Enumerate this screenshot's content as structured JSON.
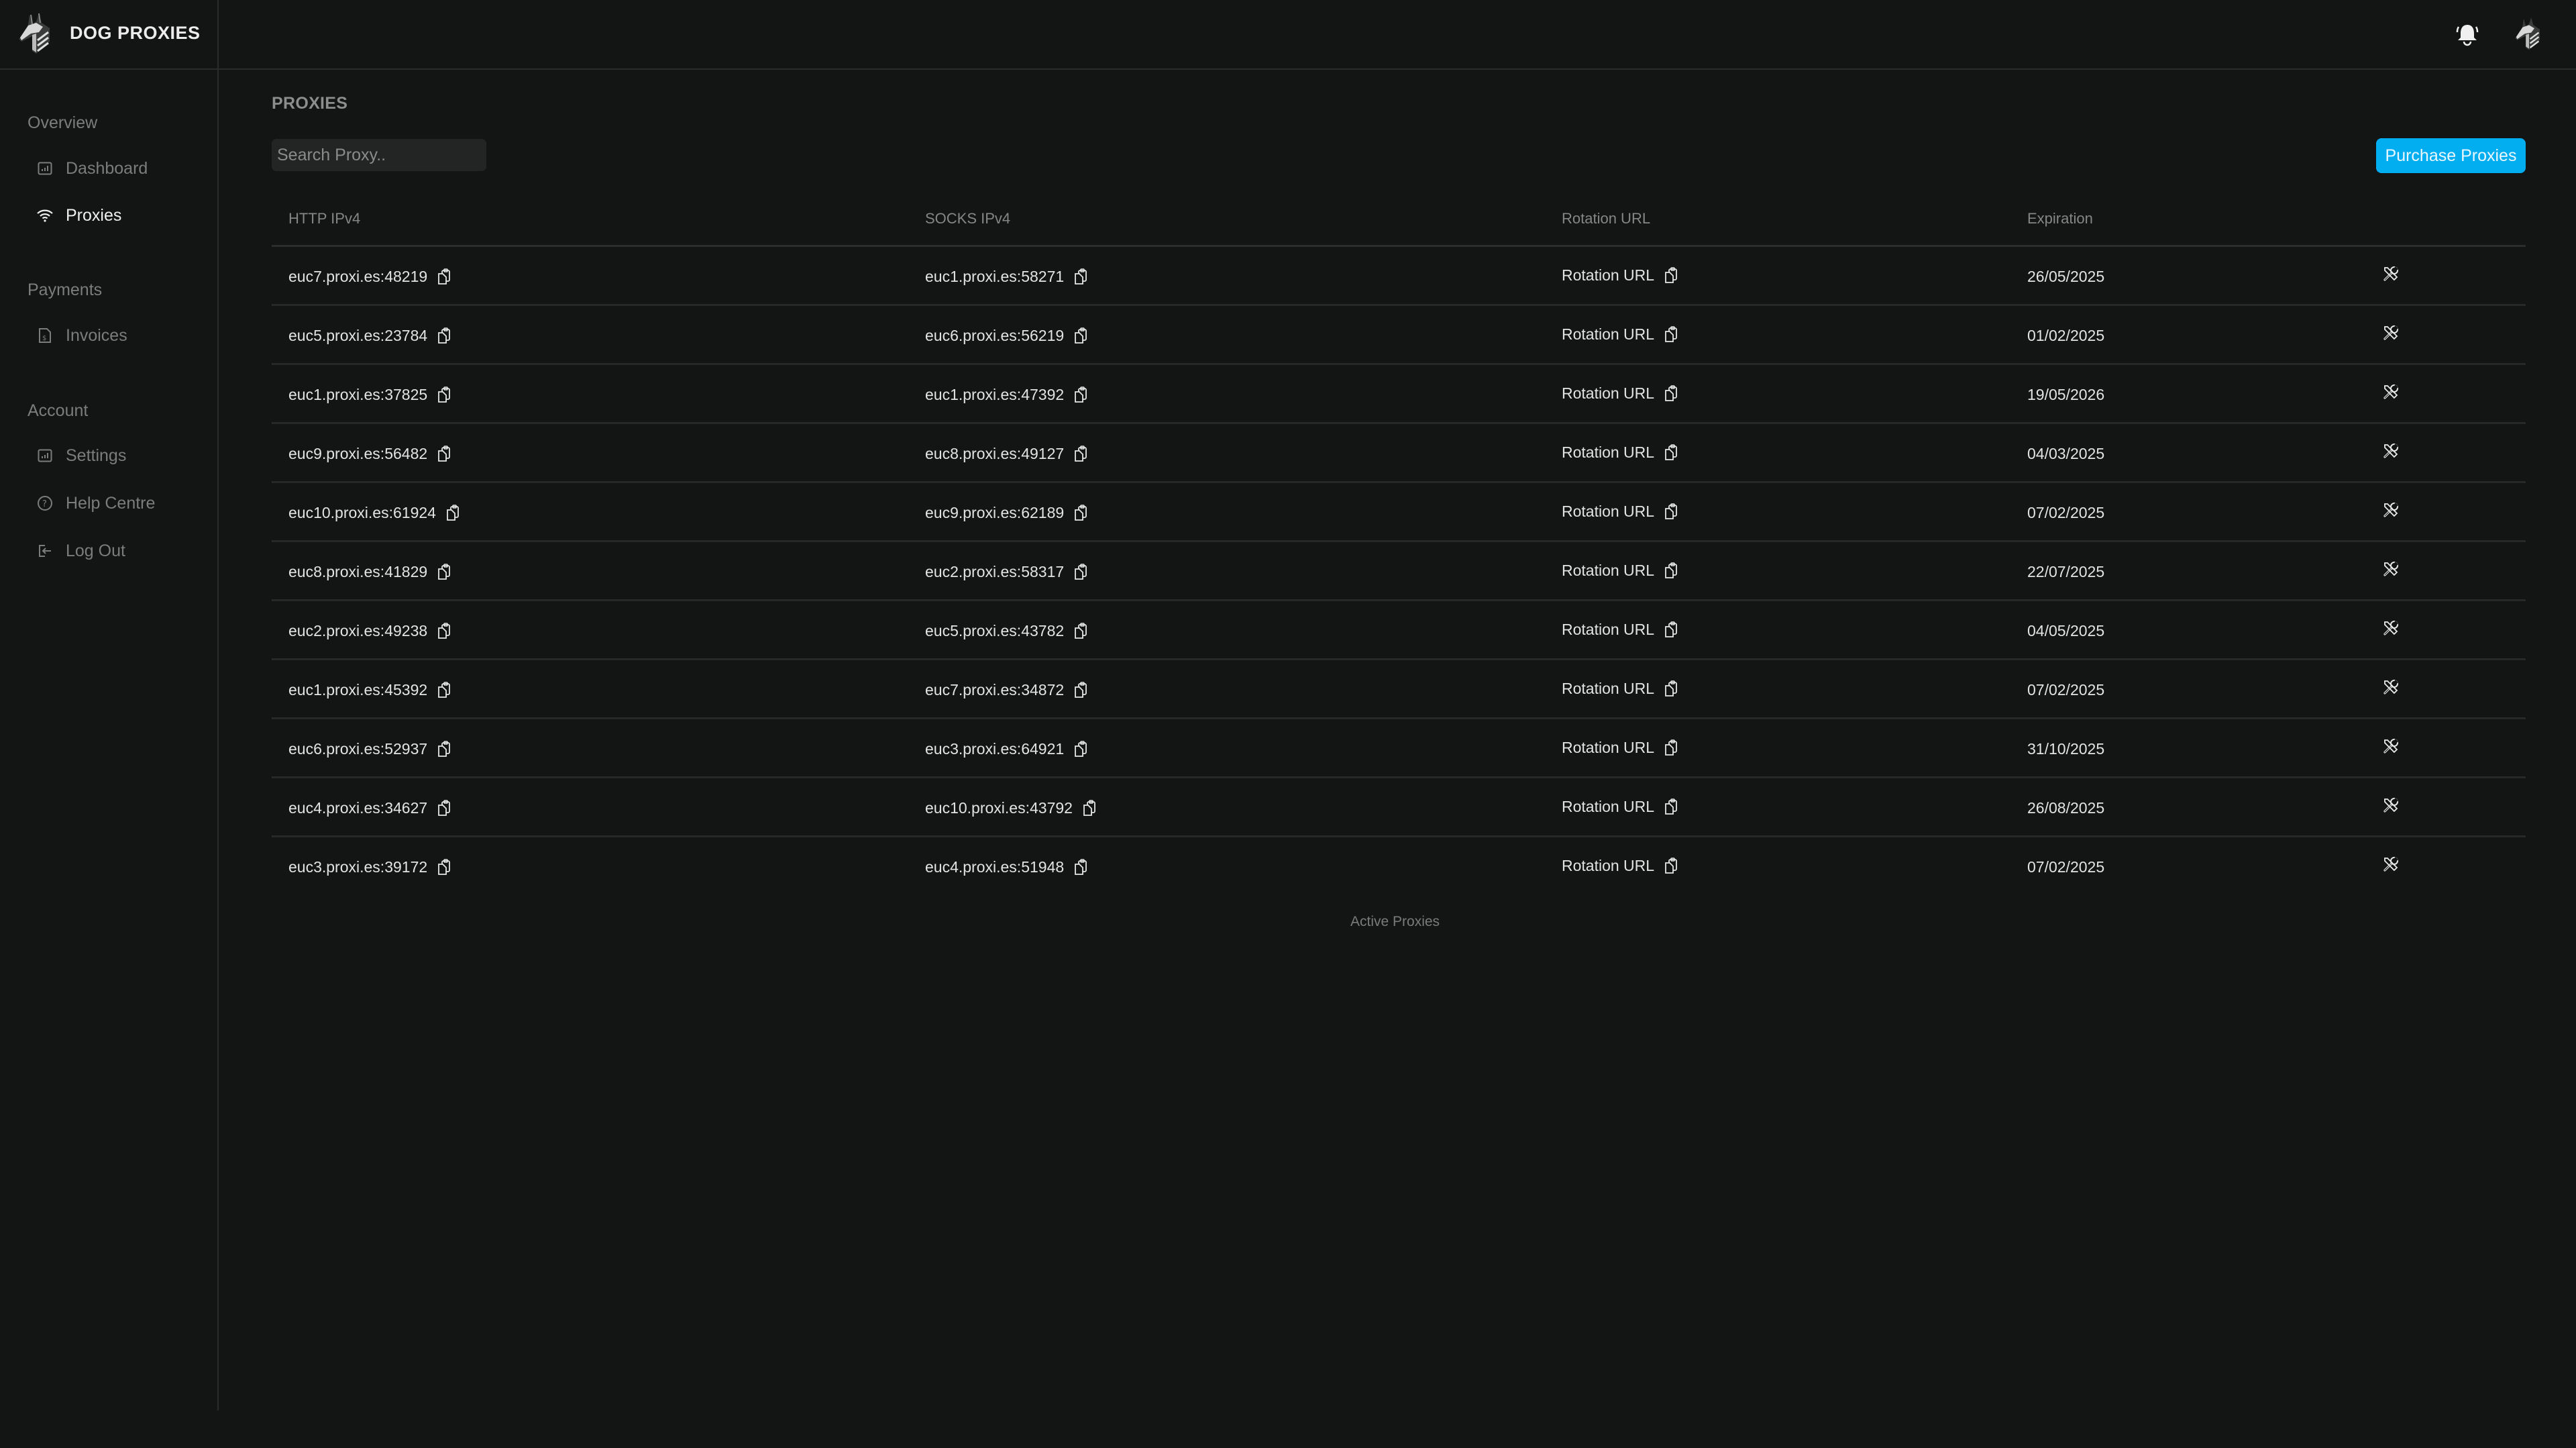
{
  "brand": {
    "name": "DOG PROXIES",
    "logo_icon": "dog-head-logo"
  },
  "header": {
    "icons": [
      "bell-icon",
      "user-avatar-dog-logo"
    ]
  },
  "sidebar": {
    "sections": [
      {
        "title": "Overview",
        "items": [
          {
            "label": "Dashboard",
            "icon": "chart-bar-icon",
            "active": false
          },
          {
            "label": "Proxies",
            "icon": "wifi-icon",
            "active": true
          }
        ]
      },
      {
        "title": "Payments",
        "items": [
          {
            "label": "Invoices",
            "icon": "invoice-icon",
            "active": false
          }
        ]
      },
      {
        "title": "Account",
        "items": [
          {
            "label": "Settings",
            "icon": "chart-bar-icon",
            "active": false
          },
          {
            "label": "Help Centre",
            "icon": "question-circle-icon",
            "active": false
          },
          {
            "label": "Log Out",
            "icon": "logout-icon",
            "active": false
          }
        ]
      }
    ]
  },
  "main": {
    "title": "PROXIES",
    "search": {
      "placeholder": "Search Proxy..",
      "value": ""
    },
    "purchase_button": "Purchase Proxies",
    "columns": [
      "HTTP IPv4",
      "SOCKS IPv4",
      "Rotation URL",
      "Expiration"
    ],
    "rows": [
      {
        "http": "euc7.proxi.es:48219",
        "socks": "euc1.proxi.es:58271",
        "rotation": "Rotation URL",
        "expiration": "26/05/2025"
      },
      {
        "http": "euc5.proxi.es:23784",
        "socks": "euc6.proxi.es:56219",
        "rotation": "Rotation URL",
        "expiration": "01/02/2025"
      },
      {
        "http": "euc1.proxi.es:37825",
        "socks": "euc1.proxi.es:47392",
        "rotation": "Rotation URL",
        "expiration": "19/05/2026"
      },
      {
        "http": "euc9.proxi.es:56482",
        "socks": "euc8.proxi.es:49127",
        "rotation": "Rotation URL",
        "expiration": "04/03/2025"
      },
      {
        "http": "euc10.proxi.es:61924",
        "socks": "euc9.proxi.es:62189",
        "rotation": "Rotation URL",
        "expiration": "07/02/2025"
      },
      {
        "http": "euc8.proxi.es:41829",
        "socks": "euc2.proxi.es:58317",
        "rotation": "Rotation URL",
        "expiration": "22/07/2025"
      },
      {
        "http": "euc2.proxi.es:49238",
        "socks": "euc5.proxi.es:43782",
        "rotation": "Rotation URL",
        "expiration": "04/05/2025"
      },
      {
        "http": "euc1.proxi.es:45392",
        "socks": "euc7.proxi.es:34872",
        "rotation": "Rotation URL",
        "expiration": "07/02/2025"
      },
      {
        "http": "euc6.proxi.es:52937",
        "socks": "euc3.proxi.es:64921",
        "rotation": "Rotation URL",
        "expiration": "31/10/2025"
      },
      {
        "http": "euc4.proxi.es:34627",
        "socks": "euc10.proxi.es:43792",
        "rotation": "Rotation URL",
        "expiration": "26/08/2025"
      },
      {
        "http": "euc3.proxi.es:39172",
        "socks": "euc4.proxi.es:51948",
        "rotation": "Rotation URL",
        "expiration": "07/02/2025"
      }
    ],
    "footer_label": "Active Proxies"
  },
  "colors": {
    "accent": "#03aef0",
    "background": "#131514",
    "border": "#2a2c2b"
  }
}
